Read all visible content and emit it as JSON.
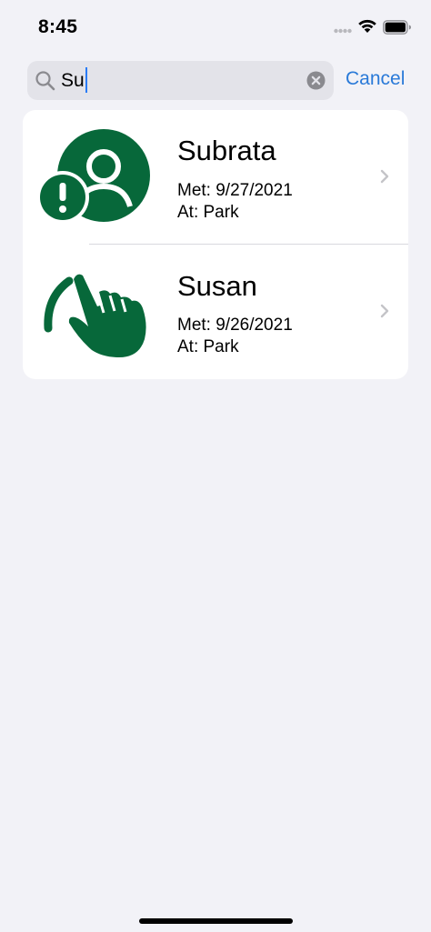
{
  "status_bar": {
    "time": "8:45"
  },
  "search": {
    "value": "Su",
    "cancel_label": "Cancel"
  },
  "results": [
    {
      "name": "Subrata",
      "met": "Met: 9/27/2021",
      "at": "At: Park",
      "icon": "person-alert-icon"
    },
    {
      "name": "Susan",
      "met": "Met: 9/26/2021",
      "at": "At: Park",
      "icon": "hand-tap-icon"
    }
  ],
  "colors": {
    "accent": "#2a7ad8",
    "icon_green": "#07683a",
    "background": "#f2f2f7",
    "caret": "#2a7cf6"
  }
}
